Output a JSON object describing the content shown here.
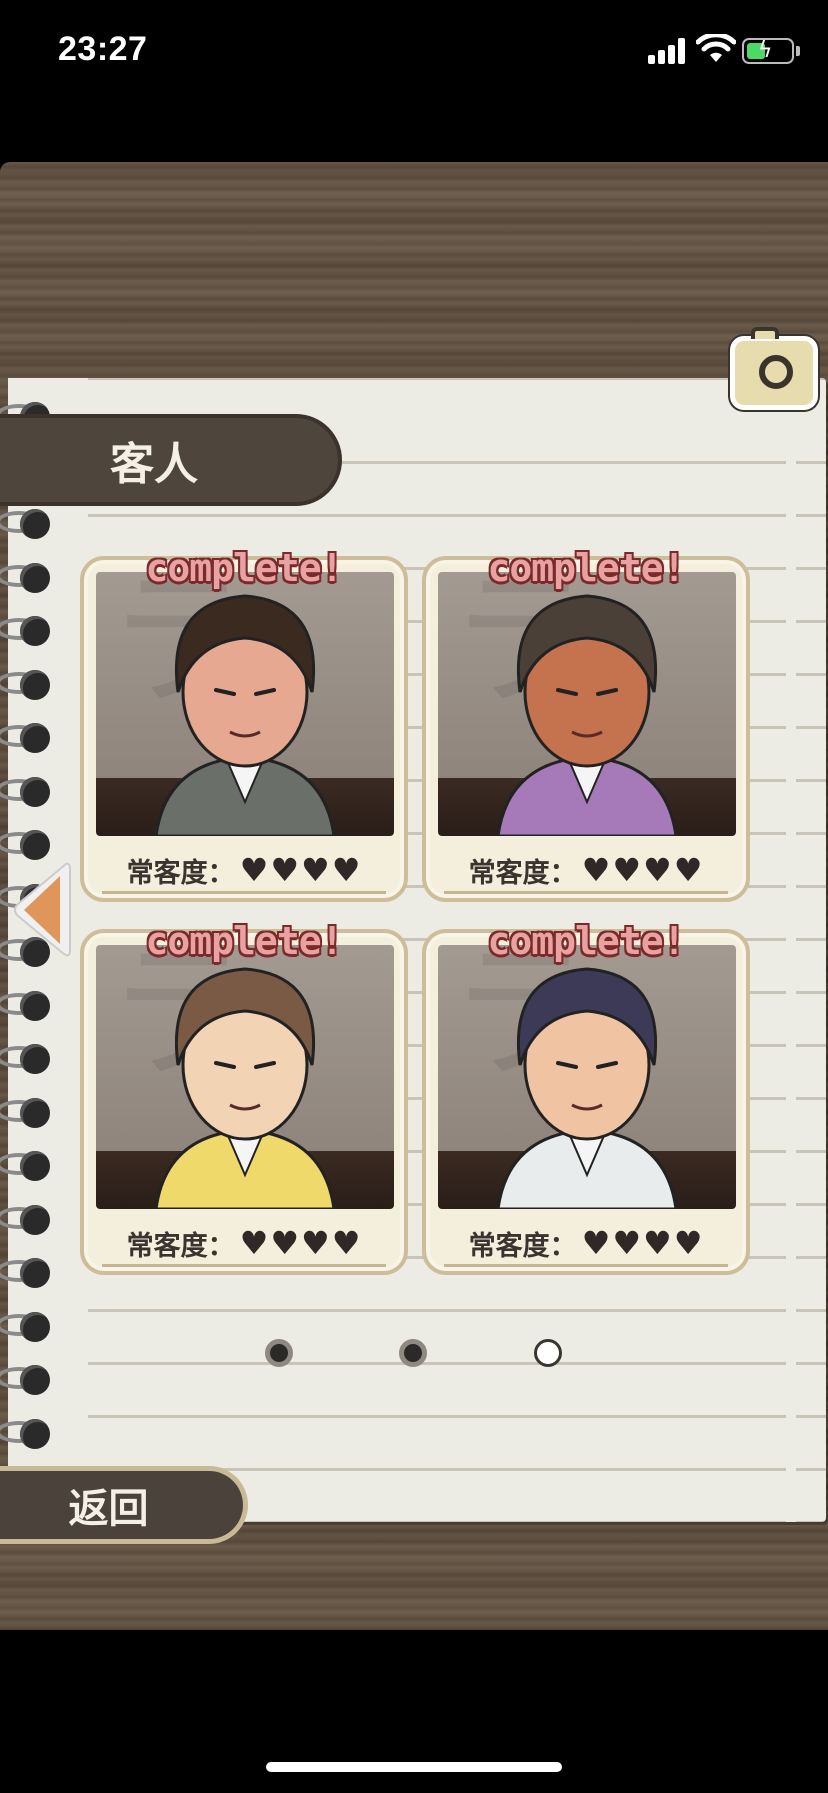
{
  "status_bar": {
    "time": "23:27"
  },
  "header": {
    "title": "客人"
  },
  "cards": [
    {
      "status": "complete!",
      "label": "常客度：",
      "hearts": 4,
      "hair": "#3b2a20",
      "skin": "#e7a891",
      "suit": "#6b6f6a"
    },
    {
      "status": "complete!",
      "label": "常客度：",
      "hearts": 4,
      "hair": "#4a4038",
      "skin": "#c5724f",
      "suit": "#a67ab8"
    },
    {
      "status": "complete!",
      "label": "常客度：",
      "hearts": 4,
      "hair": "#7a5a44",
      "skin": "#f2d3b4",
      "suit": "#efd96a"
    },
    {
      "status": "complete!",
      "label": "常客度：",
      "hearts": 4,
      "hair": "#3d3a57",
      "skin": "#f0c4a2",
      "suit": "#e8ecec"
    }
  ],
  "pagination": {
    "pages": 3,
    "current": 3
  },
  "footer": {
    "back_label": "返回"
  },
  "icons": {
    "camera": "camera-icon",
    "prev": "prev-arrow-icon",
    "heart": "♥"
  }
}
